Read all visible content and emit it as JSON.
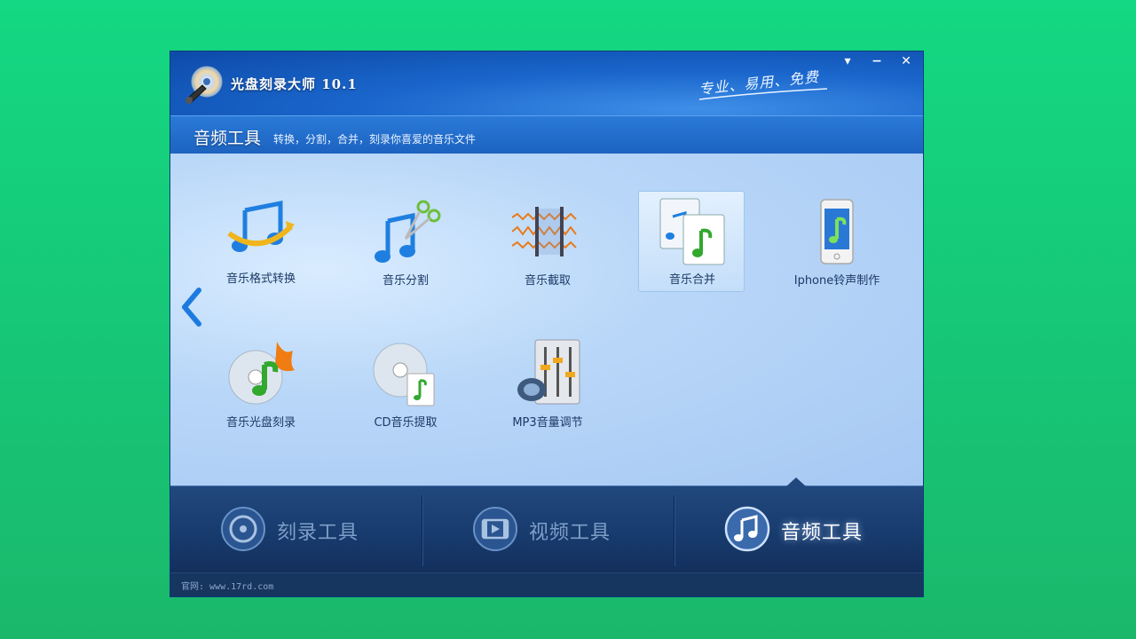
{
  "app": {
    "title": "光盘刻录大师 10.1",
    "slogan": "专业、易用、免费"
  },
  "window_controls": {
    "menu": "▾",
    "minimize": "−",
    "close": "✕"
  },
  "section": {
    "title": "音频工具",
    "subtitle": "转换，分割，合并，刻录你喜爱的音乐文件"
  },
  "tools": [
    {
      "label": "音乐格式转换",
      "icon": "music-convert-icon"
    },
    {
      "label": "音乐分割",
      "icon": "music-split-icon"
    },
    {
      "label": "音乐截取",
      "icon": "music-trim-icon"
    },
    {
      "label": "音乐合并",
      "icon": "music-merge-icon",
      "selected": true
    },
    {
      "label": "Iphone铃声制作",
      "icon": "iphone-ringtone-icon"
    },
    {
      "label": "音乐光盘刻录",
      "icon": "music-cd-burn-icon"
    },
    {
      "label": "CD音乐提取",
      "icon": "cd-rip-icon"
    },
    {
      "label": "MP3音量调节",
      "icon": "mp3-volume-icon"
    }
  ],
  "tabs": [
    {
      "label": "刻录工具",
      "icon": "disc-icon"
    },
    {
      "label": "视频工具",
      "icon": "film-icon"
    },
    {
      "label": "音频工具",
      "icon": "music-note-icon",
      "active": true
    }
  ],
  "footer": {
    "text": "官网: www.17rd.com"
  },
  "colors": {
    "accent": "#1d63c0",
    "background": "#14d883"
  }
}
